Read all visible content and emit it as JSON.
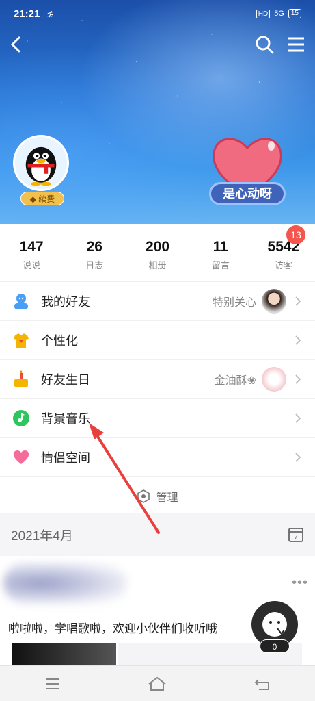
{
  "status_bar": {
    "time": "21:21",
    "extra": "≴",
    "hd": "HD",
    "signal": "5G",
    "battery": "15"
  },
  "header": {
    "renew_label": "续费",
    "tag_label": "是心动呀"
  },
  "stats": [
    {
      "num": "147",
      "label": "说说"
    },
    {
      "num": "26",
      "label": "日志"
    },
    {
      "num": "200",
      "label": "相册"
    },
    {
      "num": "11",
      "label": "留言"
    },
    {
      "num": "5542",
      "label": "访客",
      "badge": "13"
    }
  ],
  "menu": {
    "friends": {
      "label": "我的好友",
      "extra": "特别关心"
    },
    "personalize": {
      "label": "个性化"
    },
    "birthday": {
      "label": "好友生日",
      "extra": "金油酥❀"
    },
    "music": {
      "label": "背景音乐"
    },
    "couple": {
      "label": "情侣空间"
    },
    "manage": "管理"
  },
  "feed": {
    "month": "2021年4月",
    "calendar_day": "7",
    "post_text": "啦啦啦，学唱歌啦，欢迎小伙伴们收听哦",
    "fab_count": "0"
  },
  "colors": {
    "accent": "#f4554d",
    "arrow": "#e8413b"
  }
}
